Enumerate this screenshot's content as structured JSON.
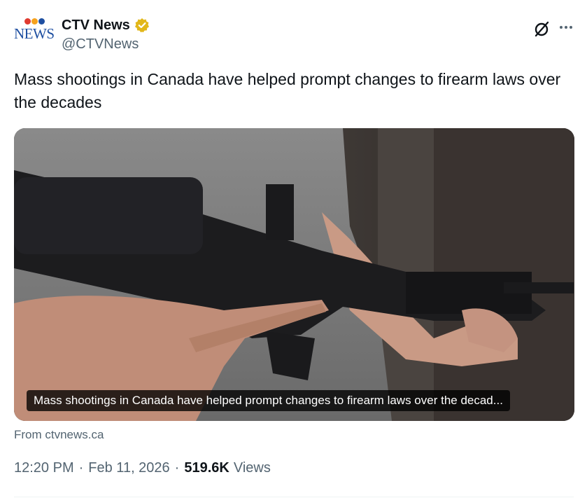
{
  "author": {
    "display_name": "CTV News",
    "handle": "@CTVNews",
    "avatar_logo_text": "NEWS",
    "logo_dot_colors": [
      "#e03a2f",
      "#f6a21e",
      "#1e4fa1"
    ],
    "verified_badge_color": "#e2b719"
  },
  "icons": {
    "grok": "grok-icon",
    "more": "more-icon",
    "verified": "verified-badge-icon"
  },
  "tweet": {
    "text": "Mass shootings in Canada have helped prompt changes to firearm laws over the decades"
  },
  "card": {
    "image_caption": "Mass shootings in Canada have helped prompt changes to firearm laws over the decad...",
    "source": "From ctvnews.ca"
  },
  "meta": {
    "time": "12:20 PM",
    "separator": "·",
    "date": "Feb 11, 2026",
    "views_count": "519.6K",
    "views_label": "Views"
  }
}
